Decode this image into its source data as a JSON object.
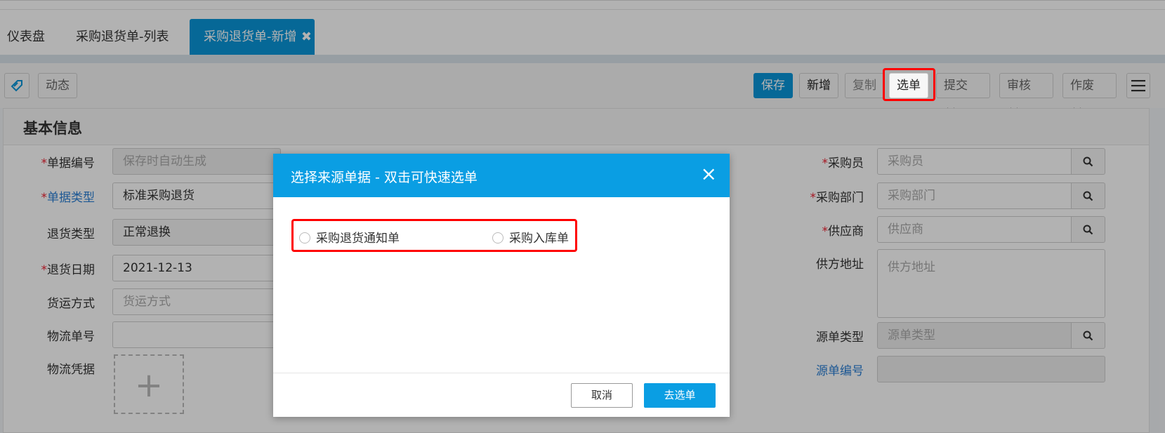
{
  "tabs": {
    "items": [
      {
        "label": "仪表盘"
      },
      {
        "label": "采购退货单-列表"
      },
      {
        "label": "采购退货单-新增"
      }
    ],
    "close_glyph": "✖"
  },
  "toolbar": {
    "dynamic_label": "动态",
    "save_label": "保存",
    "add_label": "新增",
    "copy_label": "复制",
    "pick_label": "选单",
    "submit_label": "提交",
    "audit_label": "审核",
    "void_label": "作废",
    "icons": {
      "tag": "tag-icon",
      "menu": "hamburger-menu-icon",
      "dropdown": "chevron-down-icon"
    }
  },
  "form": {
    "section_title": "基本信息",
    "left": {
      "doc_no": {
        "label": "单据编号",
        "placeholder": "保存时自动生成"
      },
      "doc_type": {
        "label": "单据类型",
        "value": "标准采购退货"
      },
      "return_type": {
        "label": "退货类型",
        "value": "正常退换"
      },
      "return_date": {
        "label": "退货日期",
        "value": "2021-12-13"
      },
      "shipping": {
        "label": "货运方式",
        "placeholder": "货运方式"
      },
      "logistics_no": {
        "label": "物流单号",
        "value": ""
      },
      "logistics_proof": {
        "label": "物流凭据",
        "upload_glyph": "+"
      }
    },
    "right": {
      "buyer": {
        "label": "采购员",
        "placeholder": "采购员"
      },
      "dept": {
        "label": "采购部门",
        "placeholder": "采购部门"
      },
      "supplier": {
        "label": "供应商",
        "placeholder": "供应商"
      },
      "supplier_addr": {
        "label": "供方地址",
        "placeholder": "供方地址"
      },
      "source_type": {
        "label": "源单类型",
        "placeholder": "源单类型"
      },
      "source_no": {
        "label": "源单编号",
        "value": ""
      }
    },
    "required_mark": "*"
  },
  "modal": {
    "title": "选择来源单据 - 双击可快速选单",
    "close_glyph": "×",
    "options": [
      {
        "label": "采购退货通知单"
      },
      {
        "label": "采购入库单"
      }
    ],
    "cancel_label": "取消",
    "go_label": "去选单"
  },
  "colors": {
    "accent": "#0a95d8",
    "highlight": "#ff0000"
  }
}
